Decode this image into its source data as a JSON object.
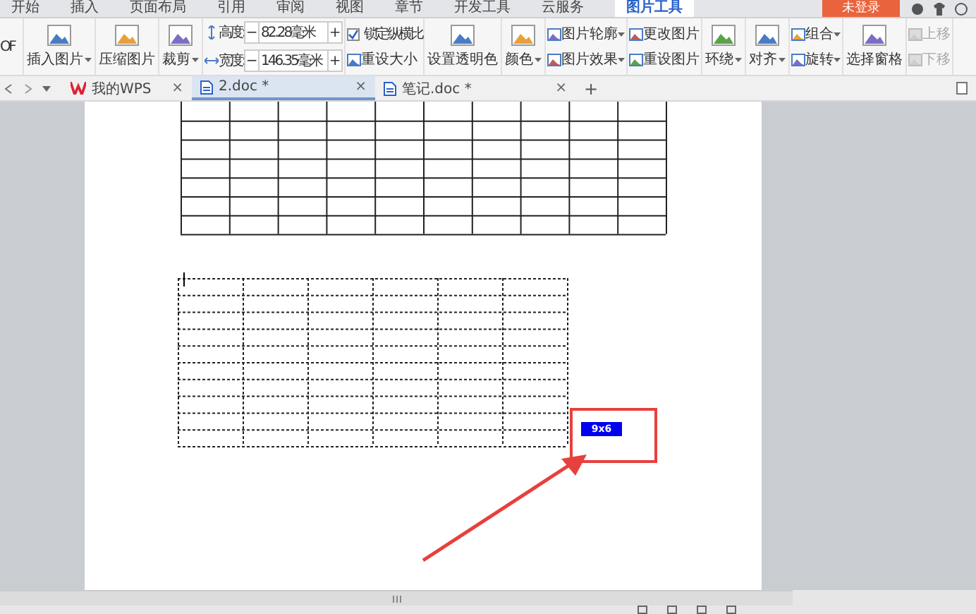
{
  "menu_tabs": [
    {
      "label": "开始",
      "selected": false
    },
    {
      "label": "插入",
      "selected": false
    },
    {
      "label": "页面布局",
      "selected": false
    },
    {
      "label": "引用",
      "selected": false
    },
    {
      "label": "审阅",
      "selected": false
    },
    {
      "label": "视图",
      "selected": false
    },
    {
      "label": "章节",
      "selected": false
    },
    {
      "label": "开发工具",
      "selected": false
    },
    {
      "label": "云服务",
      "selected": false
    },
    {
      "label": "图片工具",
      "selected": true
    }
  ],
  "login_button": "未登录",
  "ribbon": [
    {
      "kind": "text",
      "label": "OF"
    },
    {
      "kind": "big",
      "label": "插入图片",
      "dropdown": true
    },
    {
      "kind": "big",
      "label": "压缩图片",
      "dropdown": false
    },
    {
      "kind": "big",
      "label": "裁剪",
      "dropdown": true
    },
    {
      "kind": "size",
      "fields": [
        {
          "label": "高度:",
          "minus": "−",
          "value": "82.28毫米",
          "plus": "+"
        },
        {
          "label": "宽度:",
          "minus": "−",
          "value": "146.35毫米",
          "plus": "+"
        }
      ]
    },
    {
      "kind": "stack",
      "items": [
        {
          "kind": "checkbox",
          "label": "锁定纵横比",
          "checked": true
        },
        {
          "kind": "button",
          "label": "重设大小",
          "dropdown": false,
          "disabled": false
        }
      ]
    },
    {
      "kind": "big",
      "label": "设置透明色",
      "dropdown": false
    },
    {
      "kind": "big",
      "label": "颜色",
      "dropdown": true
    },
    {
      "kind": "stack",
      "items": [
        {
          "kind": "button",
          "label": "图片轮廓",
          "dropdown": true,
          "disabled": false
        },
        {
          "kind": "button",
          "label": "图片效果",
          "dropdown": true,
          "disabled": false
        }
      ]
    },
    {
      "kind": "stack",
      "items": [
        {
          "kind": "button",
          "label": "更改图片",
          "dropdown": false,
          "disabled": false
        },
        {
          "kind": "button",
          "label": "重设图片",
          "dropdown": false,
          "disabled": false
        }
      ]
    },
    {
      "kind": "big",
      "label": "环绕",
      "dropdown": true
    },
    {
      "kind": "big",
      "label": "对齐",
      "dropdown": true
    },
    {
      "kind": "stack",
      "items": [
        {
          "kind": "button",
          "label": "组合",
          "dropdown": true,
          "disabled": false
        },
        {
          "kind": "button",
          "label": "旋转",
          "dropdown": true,
          "disabled": false
        }
      ]
    },
    {
      "kind": "big",
      "label": "选择窗格",
      "dropdown": false
    },
    {
      "kind": "stack",
      "items": [
        {
          "kind": "button",
          "label": "上移",
          "dropdown": false,
          "disabled": true
        },
        {
          "kind": "button",
          "label": "下移",
          "dropdown": false,
          "disabled": true
        }
      ]
    }
  ],
  "doc_tabs": [
    {
      "label": "我的WPS",
      "kind": "home",
      "selected": false
    },
    {
      "label": "2.doc *",
      "kind": "doc",
      "selected": true
    },
    {
      "label": "笔记.doc *",
      "kind": "doc",
      "selected": false
    }
  ],
  "new_tab": "+",
  "close_mark": "×",
  "annotation": {
    "label": "9x6"
  }
}
